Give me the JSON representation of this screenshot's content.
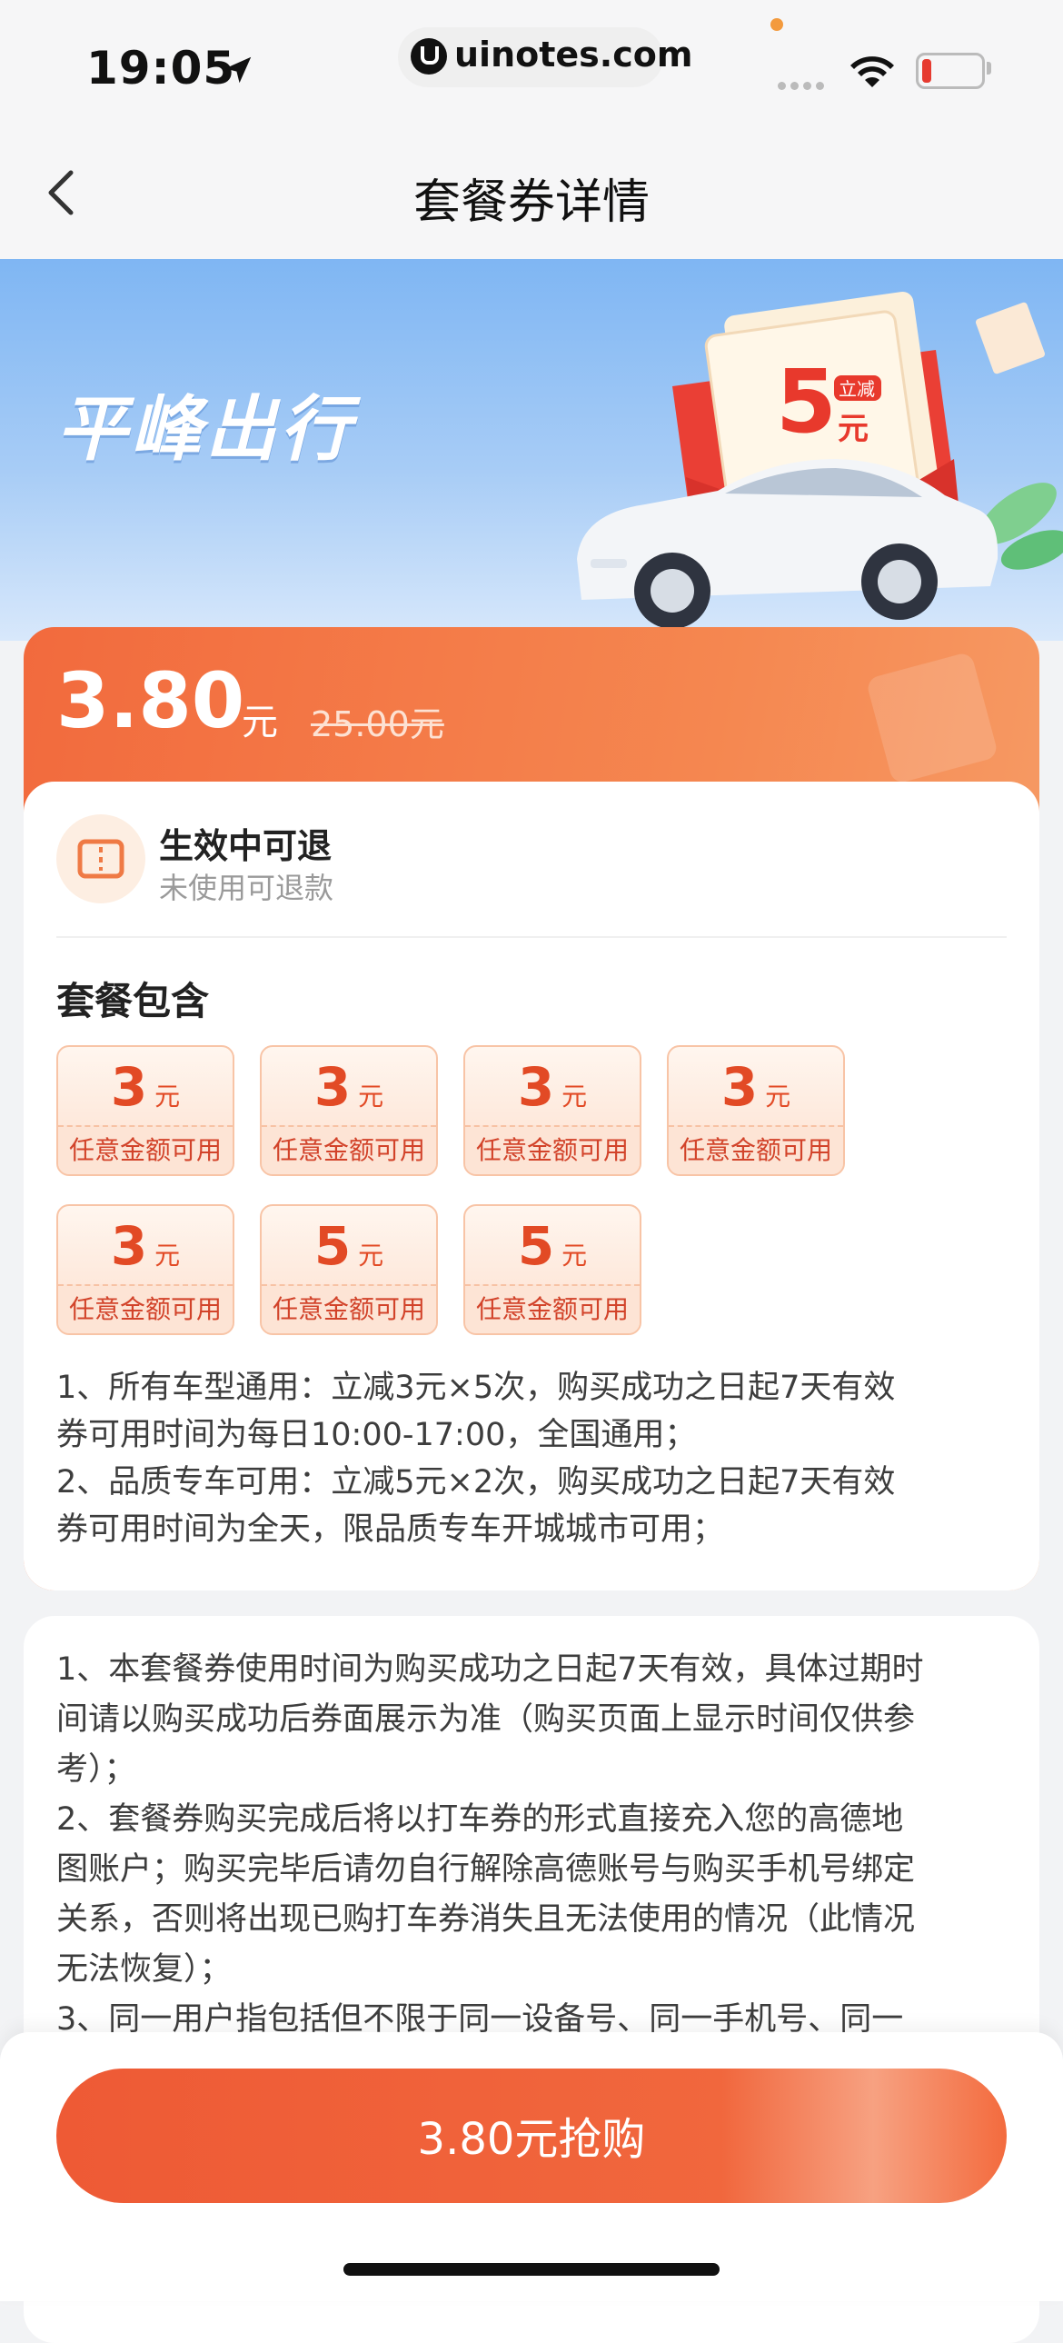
{
  "status_bar": {
    "time": "19:05",
    "url": "uinotes.com"
  },
  "nav": {
    "title": "套餐券详情"
  },
  "banner": {
    "title": "平峰出行",
    "envelope_badge": "立减",
    "envelope_amount": "5",
    "envelope_unit": "元"
  },
  "price": {
    "current": "3.80",
    "unit": "元",
    "original": "25.00元"
  },
  "refund": {
    "title": "生效中可退",
    "subtitle": "未使用可退款"
  },
  "package": {
    "title": "套餐包含",
    "coupons": [
      {
        "amount": "3",
        "unit": "元",
        "condition": "任意金额可用"
      },
      {
        "amount": "3",
        "unit": "元",
        "condition": "任意金额可用"
      },
      {
        "amount": "3",
        "unit": "元",
        "condition": "任意金额可用"
      },
      {
        "amount": "3",
        "unit": "元",
        "condition": "任意金额可用"
      },
      {
        "amount": "3",
        "unit": "元",
        "condition": "任意金额可用"
      },
      {
        "amount": "5",
        "unit": "元",
        "condition": "任意金额可用"
      },
      {
        "amount": "5",
        "unit": "元",
        "condition": "任意金额可用"
      }
    ],
    "rules": [
      "1、所有车型通用：立减3元×5次，购买成功之日起7天有效",
      "券可用时间为每日10:00-17:00，全国通用；",
      "2、品质专车可用：立减5元×2次，购买成功之日起7天有效",
      "券可用时间为全天，限品质专车开城城市可用；"
    ]
  },
  "notes": [
    "1、本套餐券使用时间为购买成功之日起7天有效，具体过期时",
    "间请以购买成功后券面展示为准（购买页面上显示时间仅供参",
    "考）；",
    "2、套餐券购买完成后将以打车券的形式直接充入您的高德地",
    "图账户；购买完毕后请勿自行解除高德账号与购买手机号绑定",
    "关系，否则将出现已购打车券消失且无法使用的情况（此情况",
    "无法恢复）；",
    "3、同一用户指包括但不限于同一设备号、同一手机号、同一"
  ],
  "buy_button": {
    "label": "3.80元抢购"
  }
}
